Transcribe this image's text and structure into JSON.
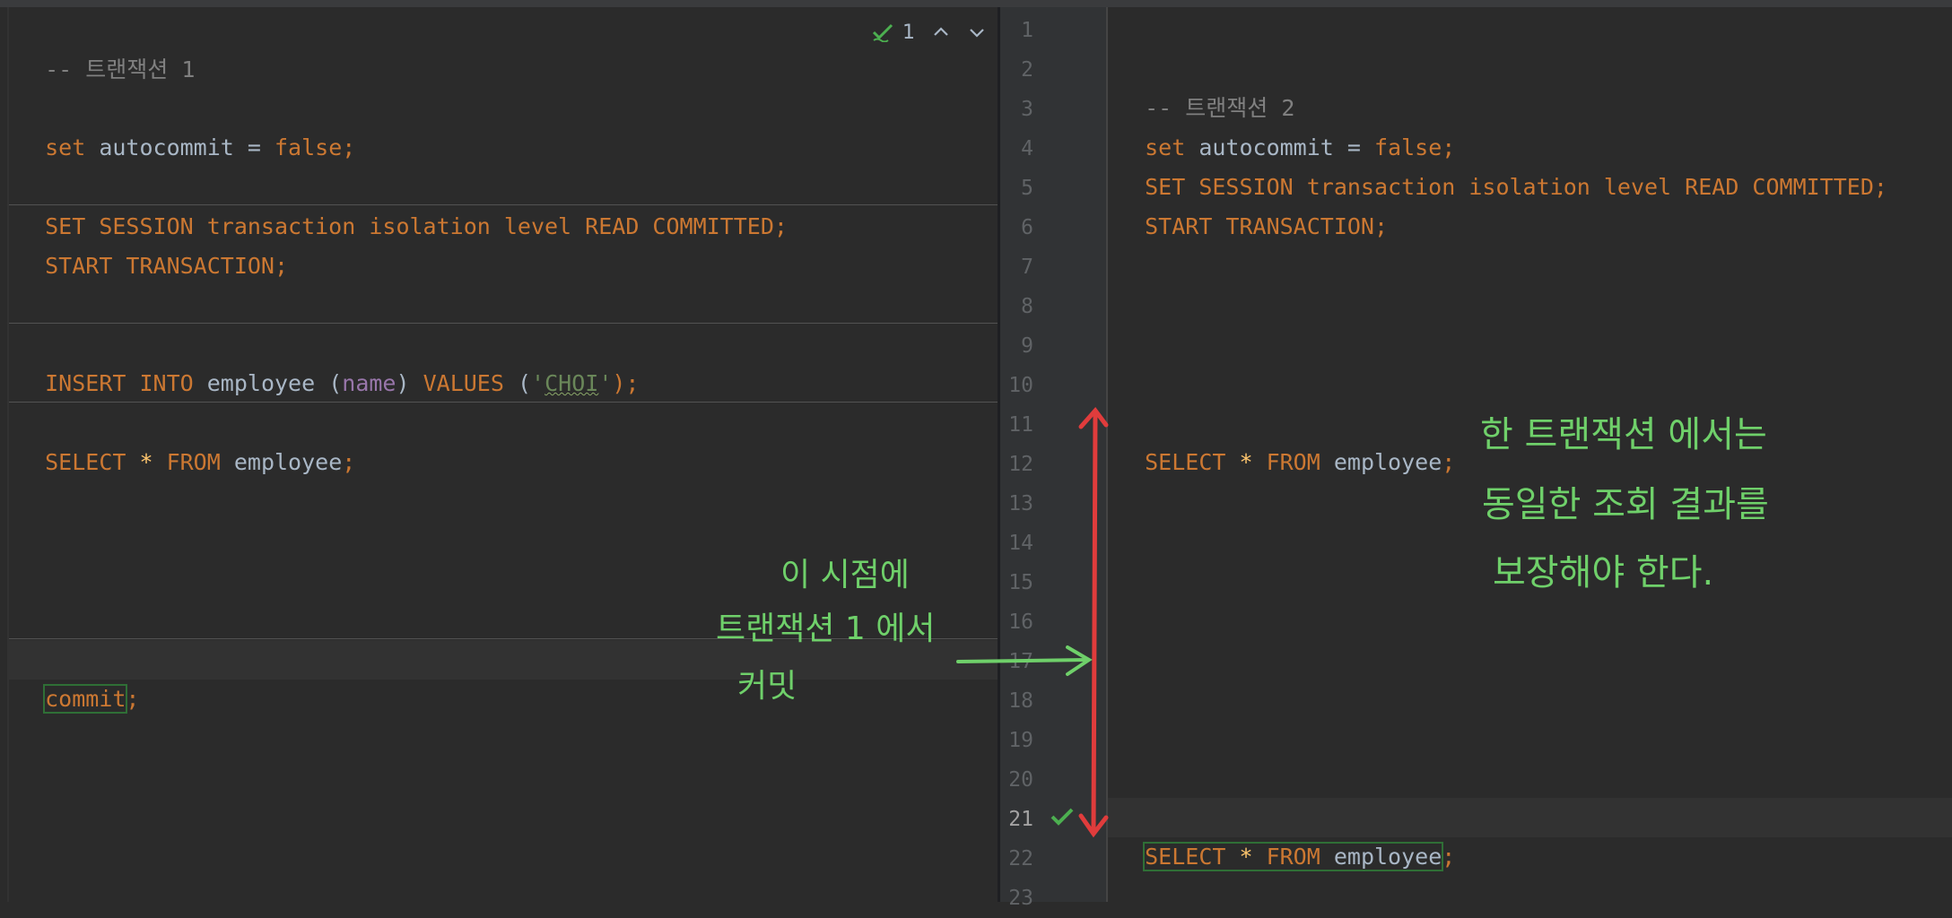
{
  "left_editor": {
    "toolbar": {
      "check_count": "1"
    },
    "lines": {
      "comment": "-- 트랜잭션 1",
      "set_kw": "set",
      "set_id": "autocommit",
      "set_eq": " = ",
      "set_val": "false",
      "set_semi": ";",
      "session_kw": "SET SESSION transaction isolation level READ COMMITTED;",
      "start_kw": "START TRANSACTION;",
      "insert_kw": "INSERT INTO",
      "insert_table": " employee ",
      "insert_paren_open": "(",
      "insert_col": "name",
      "insert_paren_close": ")",
      "insert_values_kw": " VALUES ",
      "insert_p2": "(",
      "insert_q1": "'",
      "insert_str": "CHOI",
      "insert_q2": "'",
      "insert_end": ");",
      "select_kw1": "SELECT",
      "select_star": " * ",
      "select_kw2": "FROM",
      "select_table": " employee",
      "select_semi": ";",
      "commit_kw": "commit",
      "commit_semi": ";"
    }
  },
  "right_editor": {
    "line_numbers": [
      "1",
      "2",
      "3",
      "4",
      "5",
      "6",
      "7",
      "8",
      "9",
      "10",
      "11",
      "12",
      "13",
      "14",
      "15",
      "16",
      "17",
      "18",
      "19",
      "20",
      "21",
      "22",
      "23"
    ],
    "lines": {
      "comment": "-- 트랜잭션 2",
      "set_kw": "set",
      "set_id": " autocommit",
      "set_eq": " = ",
      "set_val": "false",
      "set_semi": ";",
      "session_kw": "SET SESSION transaction isolation level READ COMMITTED;",
      "start_kw": "START TRANSACTION;",
      "select1_kw1": "SELECT",
      "select1_star": " * ",
      "select1_kw2": "FROM",
      "select1_table": " employee",
      "select1_semi": ";",
      "select2_kw1": "SELECT",
      "select2_star": " * ",
      "select2_kw2": "FROM",
      "select2_table": " employee",
      "select2_semi": ";"
    }
  },
  "annotations": {
    "left_note": [
      "이 시점에",
      "트랜잭션 1 에서",
      "커밋"
    ],
    "right_note": [
      "한 트랜잭션 에서는",
      "동일한 조회 결과를",
      "보장해야 한다."
    ]
  },
  "colors": {
    "keyword": "#cc7832",
    "identifier": "#a9b7c6",
    "comment": "#808080",
    "string": "#6a8759",
    "column": "#9876aa",
    "annotation_green": "#6fd06a",
    "annotation_red": "#e03c3c"
  }
}
